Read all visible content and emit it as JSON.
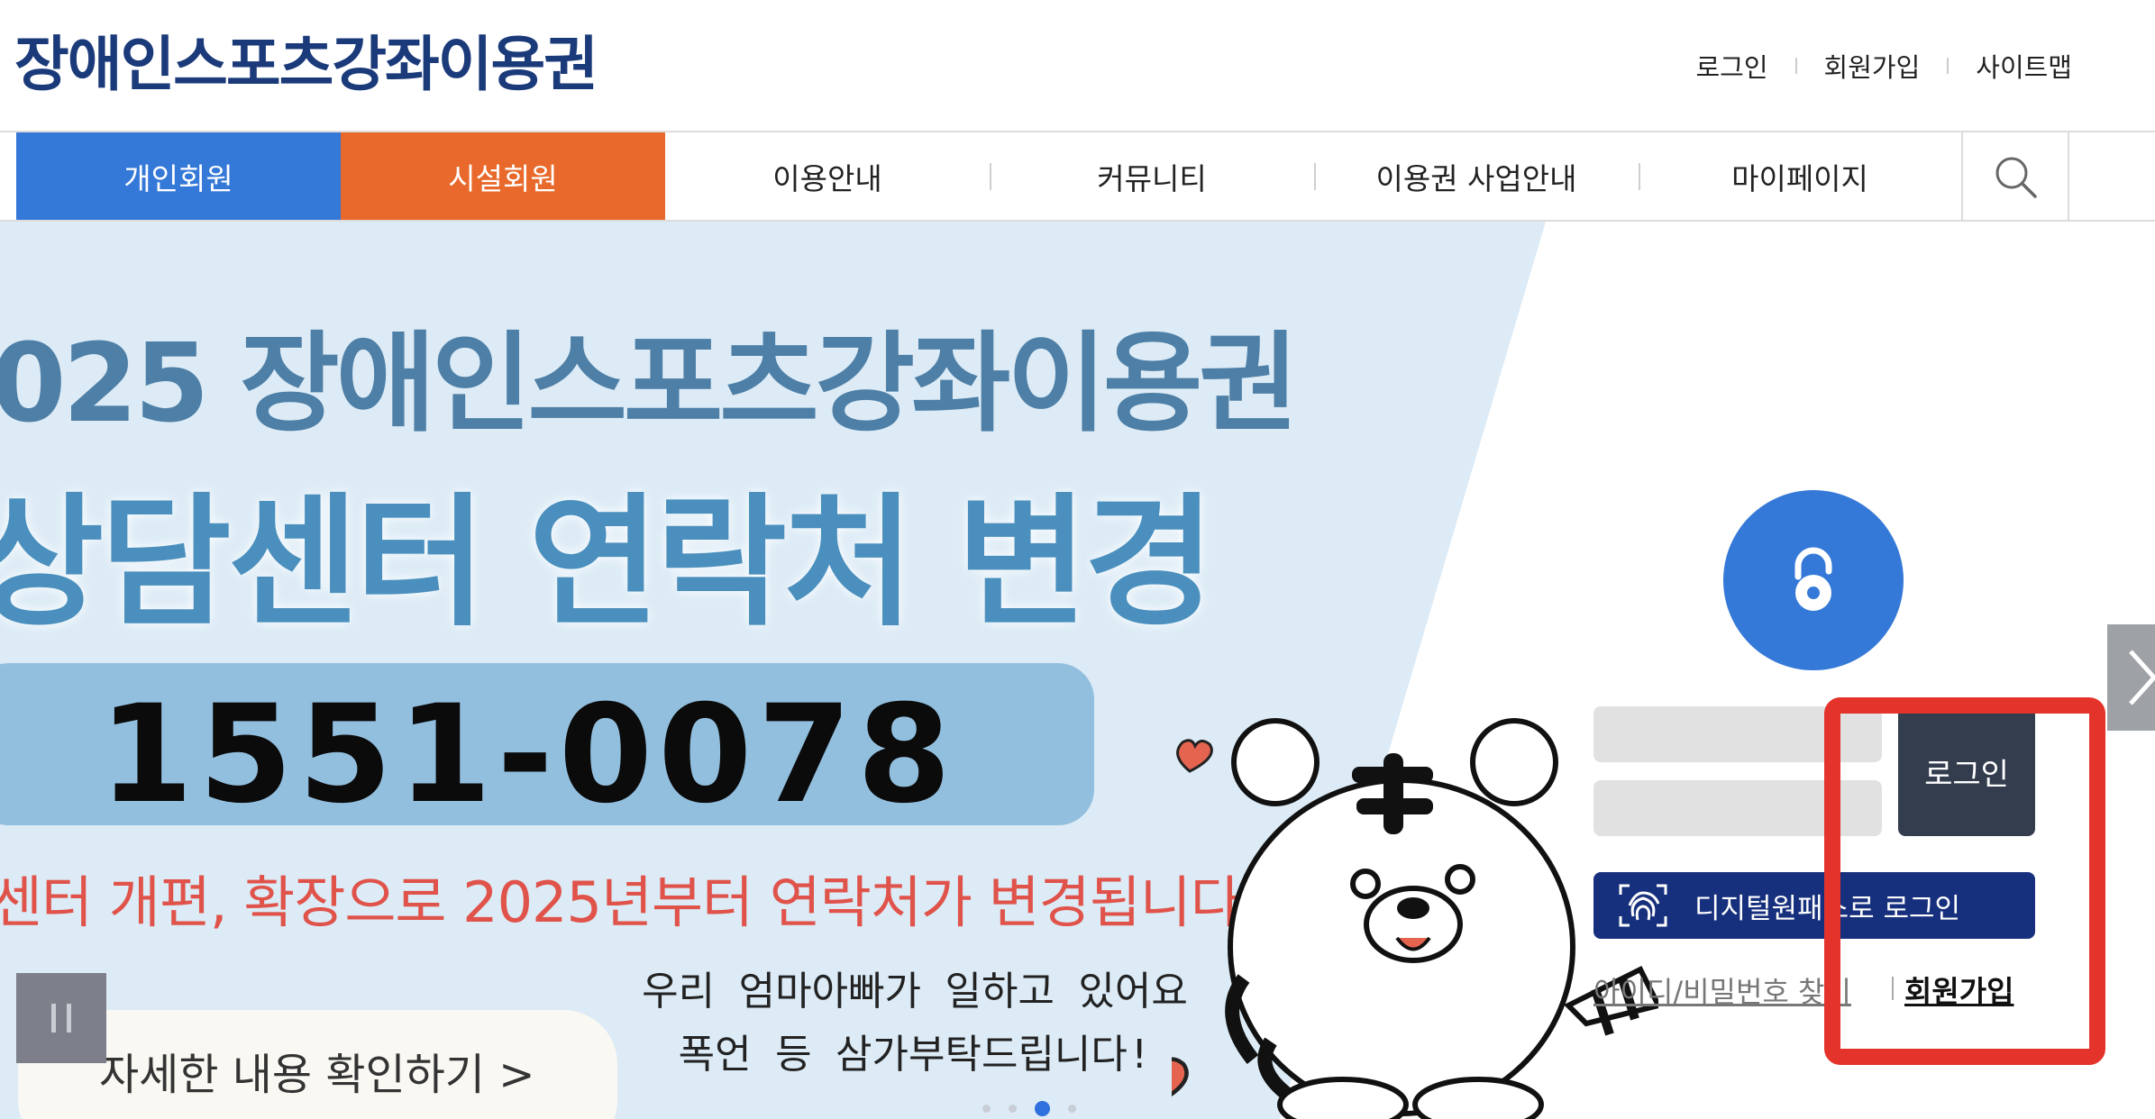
{
  "header": {
    "logo_text": "장애인스포츠강좌이용권",
    "util_links": [
      "로그인",
      "회원가입",
      "사이트맵"
    ]
  },
  "nav": {
    "items": [
      "개인회원",
      "시설회원",
      "이용안내",
      "커뮤니티",
      "이용권 사업안내",
      "마이페이지"
    ],
    "search_icon": "search-icon",
    "colors": {
      "personal": "#3579d8",
      "facility": "#e8692b"
    }
  },
  "banner": {
    "year_title": "025 장애인스포츠강좌이용권",
    "change_title": "상담센터 연락처 변경",
    "phone": "1551-0078",
    "notice": "센터 개편, 확장으로 2025년부터 연락처가 변경됩니다!",
    "speech_line1": "우리 엄마아빠가 일하고 있어요",
    "speech_line2": "폭언 등 삼가부탁드립니다!",
    "detail_link": "자세한 내용 확인하기 >",
    "slide_count": 4,
    "active_slide": 3,
    "pause_icon": "pause-icon",
    "next_icon": "chevron-right-icon"
  },
  "login": {
    "lock_icon": "lock-icon",
    "id_placeholder": "",
    "pw_placeholder": "",
    "login_button": "로그인",
    "digital_onepass_button": "디지털원패스로 로그인",
    "find_link": "아이디/비밀번호 찾기",
    "join_link": "회원가입"
  },
  "annotation": {
    "highlight_color": "#e3332a"
  }
}
